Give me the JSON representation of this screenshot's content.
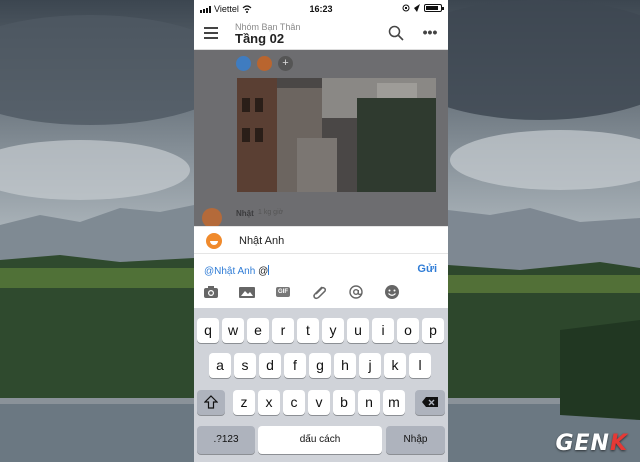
{
  "status_bar": {
    "carrier": "Viettel",
    "time": "16:23"
  },
  "header": {
    "group_name": "Nhóm Bạn Thân",
    "room_name": "Tầng 02",
    "menu_icon": "hamburger-icon",
    "search_icon": "search-icon",
    "more_icon": "more-icon"
  },
  "chat": {
    "reactions": [
      {
        "icon": "reaction-icon",
        "color": "#3f7cc0"
      },
      {
        "icon": "reaction-icon",
        "color": "#b9652f"
      },
      {
        "icon": "add-reaction-icon",
        "label": "+"
      }
    ],
    "last_message": {
      "sender": "Nhật",
      "time": "1 kg giờ"
    }
  },
  "mention_suggestion": {
    "name": "Nhật Anh",
    "avatar_color": "#f08a2c"
  },
  "compose": {
    "mention_text": "@Nhật Anh",
    "typed_text": " @",
    "send_label": "Gửi",
    "tools": [
      "camera-icon",
      "image-icon",
      "gif-icon",
      "attachment-icon",
      "at-icon",
      "emoji-icon"
    ],
    "gif_label": "GIF"
  },
  "keyboard": {
    "row1": [
      "q",
      "w",
      "e",
      "r",
      "t",
      "y",
      "u",
      "i",
      "o",
      "p"
    ],
    "row2": [
      "a",
      "s",
      "d",
      "f",
      "g",
      "h",
      "j",
      "k",
      "l"
    ],
    "row3": [
      "z",
      "x",
      "c",
      "v",
      "b",
      "n",
      "m"
    ],
    "shift_icon": "shift-icon",
    "backspace_icon": "backspace-icon",
    "numbers_label": ".?123",
    "space_label": "dấu cách",
    "return_label": "Nhập"
  },
  "watermark": {
    "text_main": "GEN",
    "text_accent": "K"
  },
  "colors": {
    "accent": "#2f7cd6",
    "keyboard_bg": "#d0d3d9"
  }
}
